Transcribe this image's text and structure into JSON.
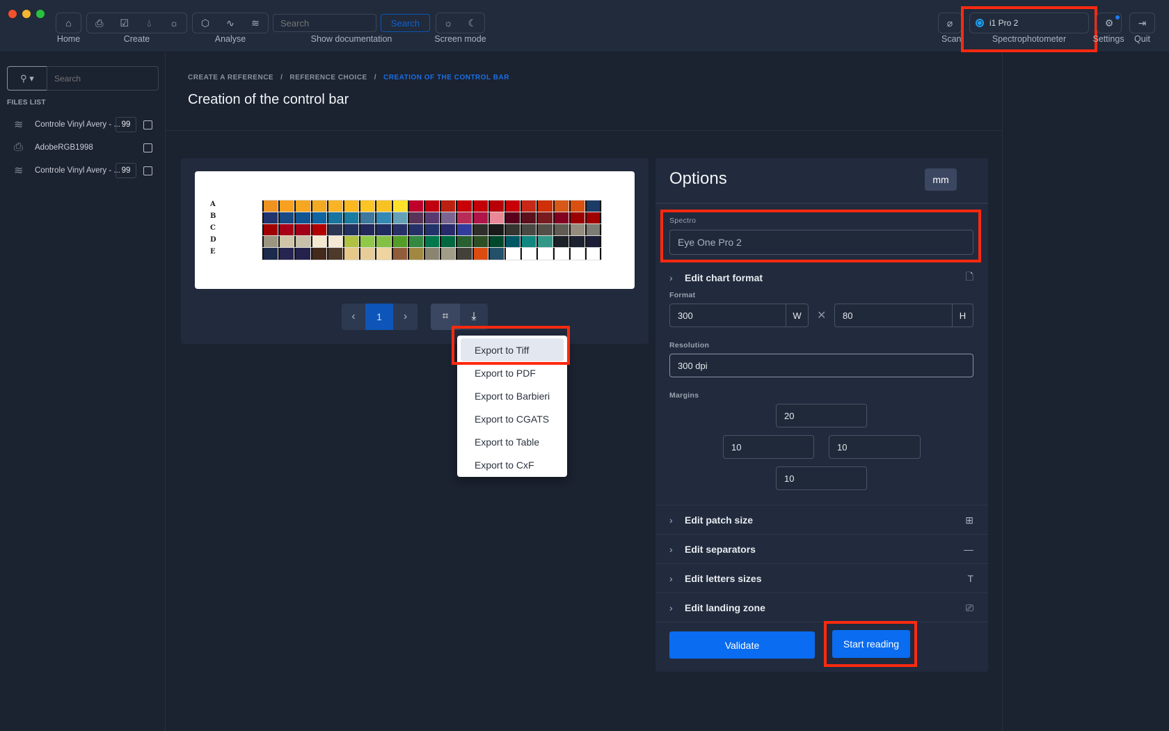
{
  "toolbar": {
    "groups": [
      {
        "label": "Home",
        "icons": [
          "home-icon"
        ]
      },
      {
        "label": "Create",
        "icons": [
          "printer-icon",
          "checkbox-icon",
          "drop-icon",
          "sun-icon"
        ]
      },
      {
        "label": "Analyse",
        "icons": [
          "cube-icon",
          "activity-icon",
          "layers-icon"
        ]
      }
    ],
    "search_placeholder": "Search",
    "search_button": "Search",
    "doc_label": "Show documentation",
    "screen_mode_label": "Screen mode",
    "scan_label": "Scan",
    "spectro_device": "i1 Pro 2",
    "spectro_label": "Spectrophotometer",
    "settings_label": "Settings",
    "quit_label": "Quit"
  },
  "sidebar": {
    "search_placeholder": "Search",
    "files_title": "FILES LIST",
    "files": [
      {
        "name": "Controle Vinyl Avery - ...",
        "count": "99",
        "icon": "layers-icon"
      },
      {
        "name": "AdobeRGB1998",
        "count": "",
        "icon": "printer-icon"
      },
      {
        "name": "Controle Vinyl Avery - ...",
        "count": "99",
        "icon": "layers-icon"
      }
    ]
  },
  "breadcrumb": [
    "CREATE A REFERENCE",
    "REFERENCE CHOICE",
    "CREATION OF THE CONTROL BAR"
  ],
  "page_title": "Creation of the control bar",
  "preview": {
    "row_labels": [
      "A",
      "B",
      "C",
      "D",
      "E"
    ],
    "patches": [
      [
        "#ef9320",
        "#f8a020",
        "#f6a620",
        "#f1aa22",
        "#f9b325",
        "#fbb820",
        "#fdc523",
        "#f8c322",
        "#fde02a",
        "#c0002a",
        "#c00010",
        "#bb2010",
        "#c80008",
        "#c40008",
        "#b80008",
        "#c80008",
        "#c82818",
        "#d03008",
        "#d85818",
        "#da5010",
        "#1c3c68"
      ],
      [
        "#22346e",
        "#184a84",
        "#105494",
        "#1064a0",
        "#1874a0",
        "#1a7ca0",
        "#3e789e",
        "#3488b4",
        "#64a0b8",
        "#5a3458",
        "#583a70",
        "#7c6490",
        "#b82c58",
        "#b01448",
        "#ea8898",
        "#58001c",
        "#5c101c",
        "#781c20",
        "#840020",
        "#9c0000",
        "#a00000"
      ],
      [
        "#a00000",
        "#a80018",
        "#a00018",
        "#b00000",
        "#2c3454",
        "#22305c",
        "#22285a",
        "#1e2c60",
        "#283068",
        "#263068",
        "#22326a",
        "#282a6c",
        "#323c9c",
        "#302e2a",
        "#1a1a1a",
        "#343430",
        "#4a4842",
        "#545048",
        "#605c54",
        "#948c7c",
        "#7c7c74"
      ],
      [
        "#9c9680",
        "#d0c4a8",
        "#c8c0a8",
        "#f4e8d0",
        "#f4e8d4",
        "#b0c040",
        "#90c848",
        "#84c044",
        "#549c28",
        "#348840",
        "#00784c",
        "#006840",
        "#286030",
        "#2c5024",
        "#00482c",
        "#005864",
        "#108880",
        "#349888",
        "#1c2028",
        "#1c2230",
        "#1c1e38"
      ],
      [
        "#1c2a4c",
        "#262450",
        "#24224c",
        "#442a1c",
        "#4e3a2a",
        "#e8c888",
        "#e8cc98",
        "#eed4a0",
        "#905c3a",
        "#a08840",
        "#8a8470",
        "#a09c88",
        "#44403a",
        "#dc4c10",
        "#24506a",
        "#ffffff",
        "#ffffff",
        "#ffffff",
        "#ffffff",
        "#ffffff",
        "#ffffff"
      ]
    ],
    "page": "1",
    "export_menu": [
      "Export to Tiff",
      "Export to PDF",
      "Export to Barbieri",
      "Export to CGATS",
      "Export to Table",
      "Export to CxF"
    ]
  },
  "options": {
    "title": "Options",
    "unit": "mm",
    "spectro_label": "Spectro",
    "spectro_value": "Eye One Pro 2",
    "chart_format": "Edit chart format",
    "format_label": "Format",
    "width": "300",
    "width_unit": "W",
    "height": "80",
    "height_unit": "H",
    "resolution_label": "Resolution",
    "resolution": "300 dpi",
    "margins_label": "Margins",
    "margins": {
      "top": "20",
      "left": "10",
      "right": "10",
      "bottom": "10"
    },
    "sections": [
      {
        "label": "Edit patch size",
        "icon": "grid-icon"
      },
      {
        "label": "Edit separators",
        "icon": "minus-icon"
      },
      {
        "label": "Edit letters sizes",
        "icon": "text-icon"
      },
      {
        "label": "Edit landing zone",
        "icon": "monitor-icon"
      }
    ],
    "validate": "Validate",
    "start_reading": "Start reading"
  },
  "colors": {
    "accent": "#0a6cf0",
    "highlight": "#ff2a10",
    "page_active": "#0d55b8"
  }
}
